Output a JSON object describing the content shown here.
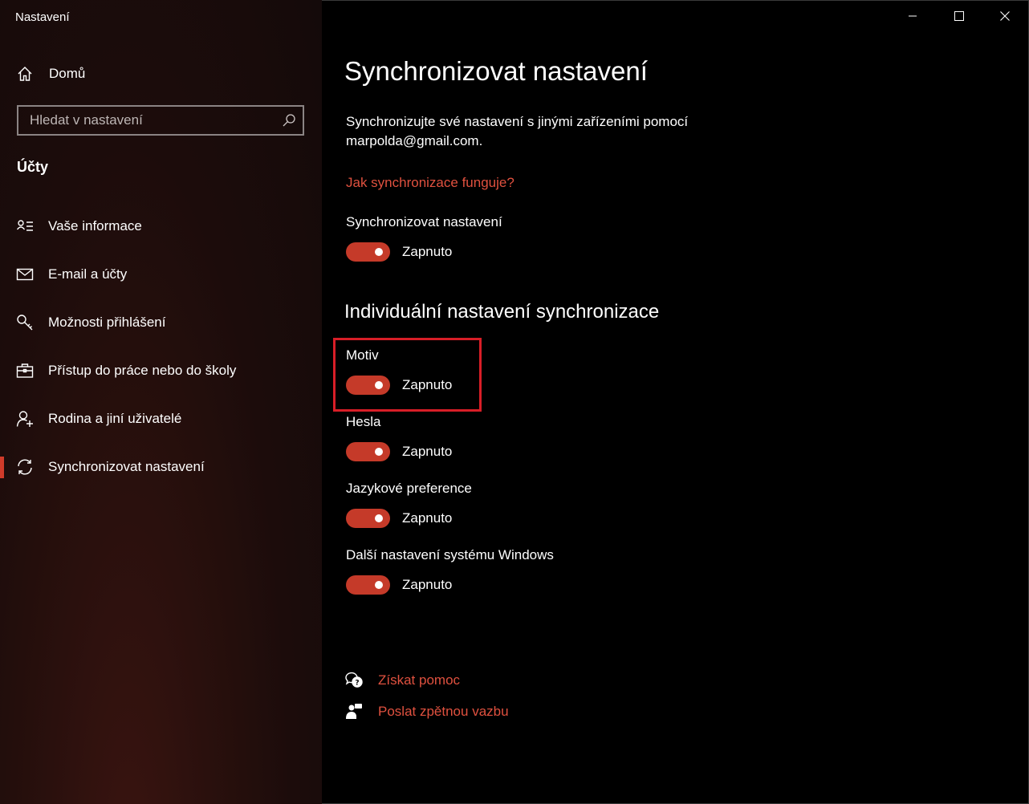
{
  "window": {
    "title": "Nastavení"
  },
  "sidebar": {
    "home_label": "Domů",
    "search": {
      "placeholder": "Hledat v nastavení",
      "value": ""
    },
    "section_label": "Účty",
    "items": [
      {
        "label": "Vaše informace",
        "icon": "contact-card-icon"
      },
      {
        "label": "E-mail a účty",
        "icon": "mail-icon"
      },
      {
        "label": "Možnosti přihlášení",
        "icon": "key-icon"
      },
      {
        "label": "Přístup do práce nebo do školy",
        "icon": "briefcase-icon"
      },
      {
        "label": "Rodina a jiní uživatelé",
        "icon": "add-user-icon"
      },
      {
        "label": "Synchronizovat nastavení",
        "icon": "sync-icon",
        "selected": true
      }
    ]
  },
  "main": {
    "title": "Synchronizovat nastavení",
    "description": "Synchronizujte své nastavení s jinými zařízeními pomocí marpolda@gmail.com.",
    "help_link": "Jak synchronizace funguje?",
    "master": {
      "label": "Synchronizovat nastavení",
      "state": "Zapnuto",
      "on": true
    },
    "individual_heading": "Individuální nastavení synchronizace",
    "settings": [
      {
        "label": "Motiv",
        "state": "Zapnuto",
        "on": true,
        "highlighted": true
      },
      {
        "label": "Hesla",
        "state": "Zapnuto",
        "on": true
      },
      {
        "label": "Jazykové preference",
        "state": "Zapnuto",
        "on": true
      },
      {
        "label": "Další nastavení systému Windows",
        "state": "Zapnuto",
        "on": true
      }
    ],
    "footer": {
      "get_help": "Získat pomoc",
      "feedback": "Poslat zpětnou vazbu"
    }
  },
  "colors": {
    "accent": "#c53a29",
    "link": "#e0513f",
    "highlight": "#d81e27",
    "background": "#000000"
  }
}
